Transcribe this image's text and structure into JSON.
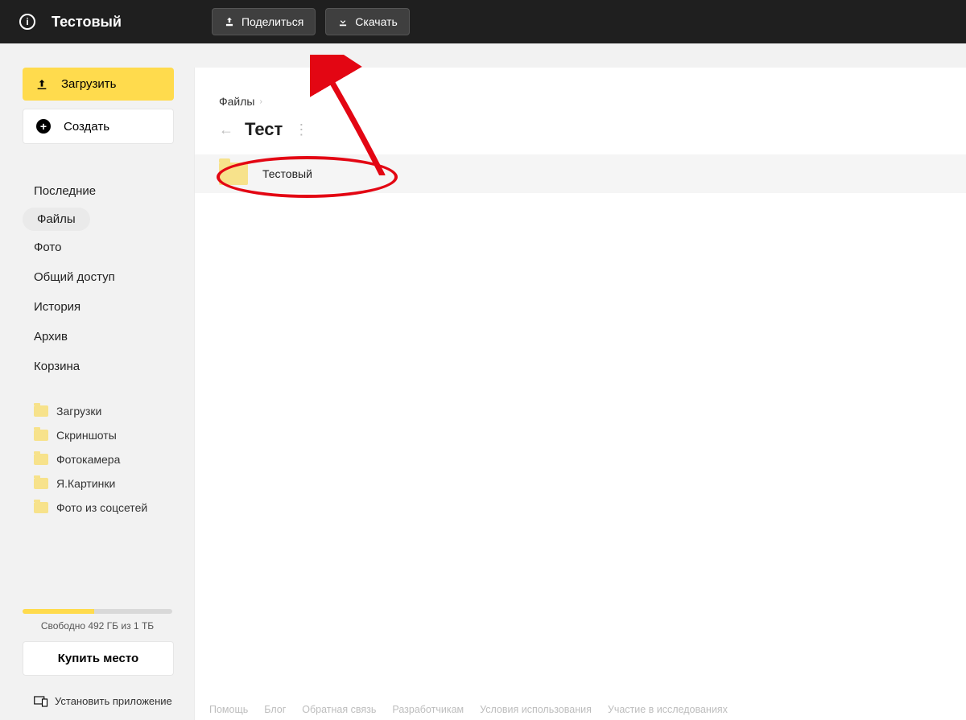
{
  "topbar": {
    "title": "Тестовый",
    "share_label": "Поделиться",
    "download_label": "Скачать"
  },
  "sidebar": {
    "upload_label": "Загрузить",
    "create_label": "Создать",
    "nav": [
      {
        "label": "Последние",
        "active": false
      },
      {
        "label": "Файлы",
        "active": true
      },
      {
        "label": "Фото",
        "active": false
      },
      {
        "label": "Общий доступ",
        "active": false
      },
      {
        "label": "История",
        "active": false
      },
      {
        "label": "Архив",
        "active": false
      },
      {
        "label": "Корзина",
        "active": false
      }
    ],
    "folders": [
      {
        "label": "Загрузки"
      },
      {
        "label": "Скриншоты"
      },
      {
        "label": "Фотокамера"
      },
      {
        "label": "Я.Картинки"
      },
      {
        "label": "Фото из соцсетей"
      }
    ],
    "storage_text": "Свободно 492 ГБ из 1 ТБ",
    "buy_label": "Купить место",
    "install_label": "Установить приложение"
  },
  "main": {
    "breadcrumb_root": "Файлы",
    "folder_title": "Тест",
    "items": [
      {
        "name": "Тестовый"
      }
    ]
  },
  "footer": {
    "links": [
      "Помощь",
      "Блог",
      "Обратная связь",
      "Разработчикам",
      "Условия использования",
      "Участие в исследованиях"
    ]
  }
}
